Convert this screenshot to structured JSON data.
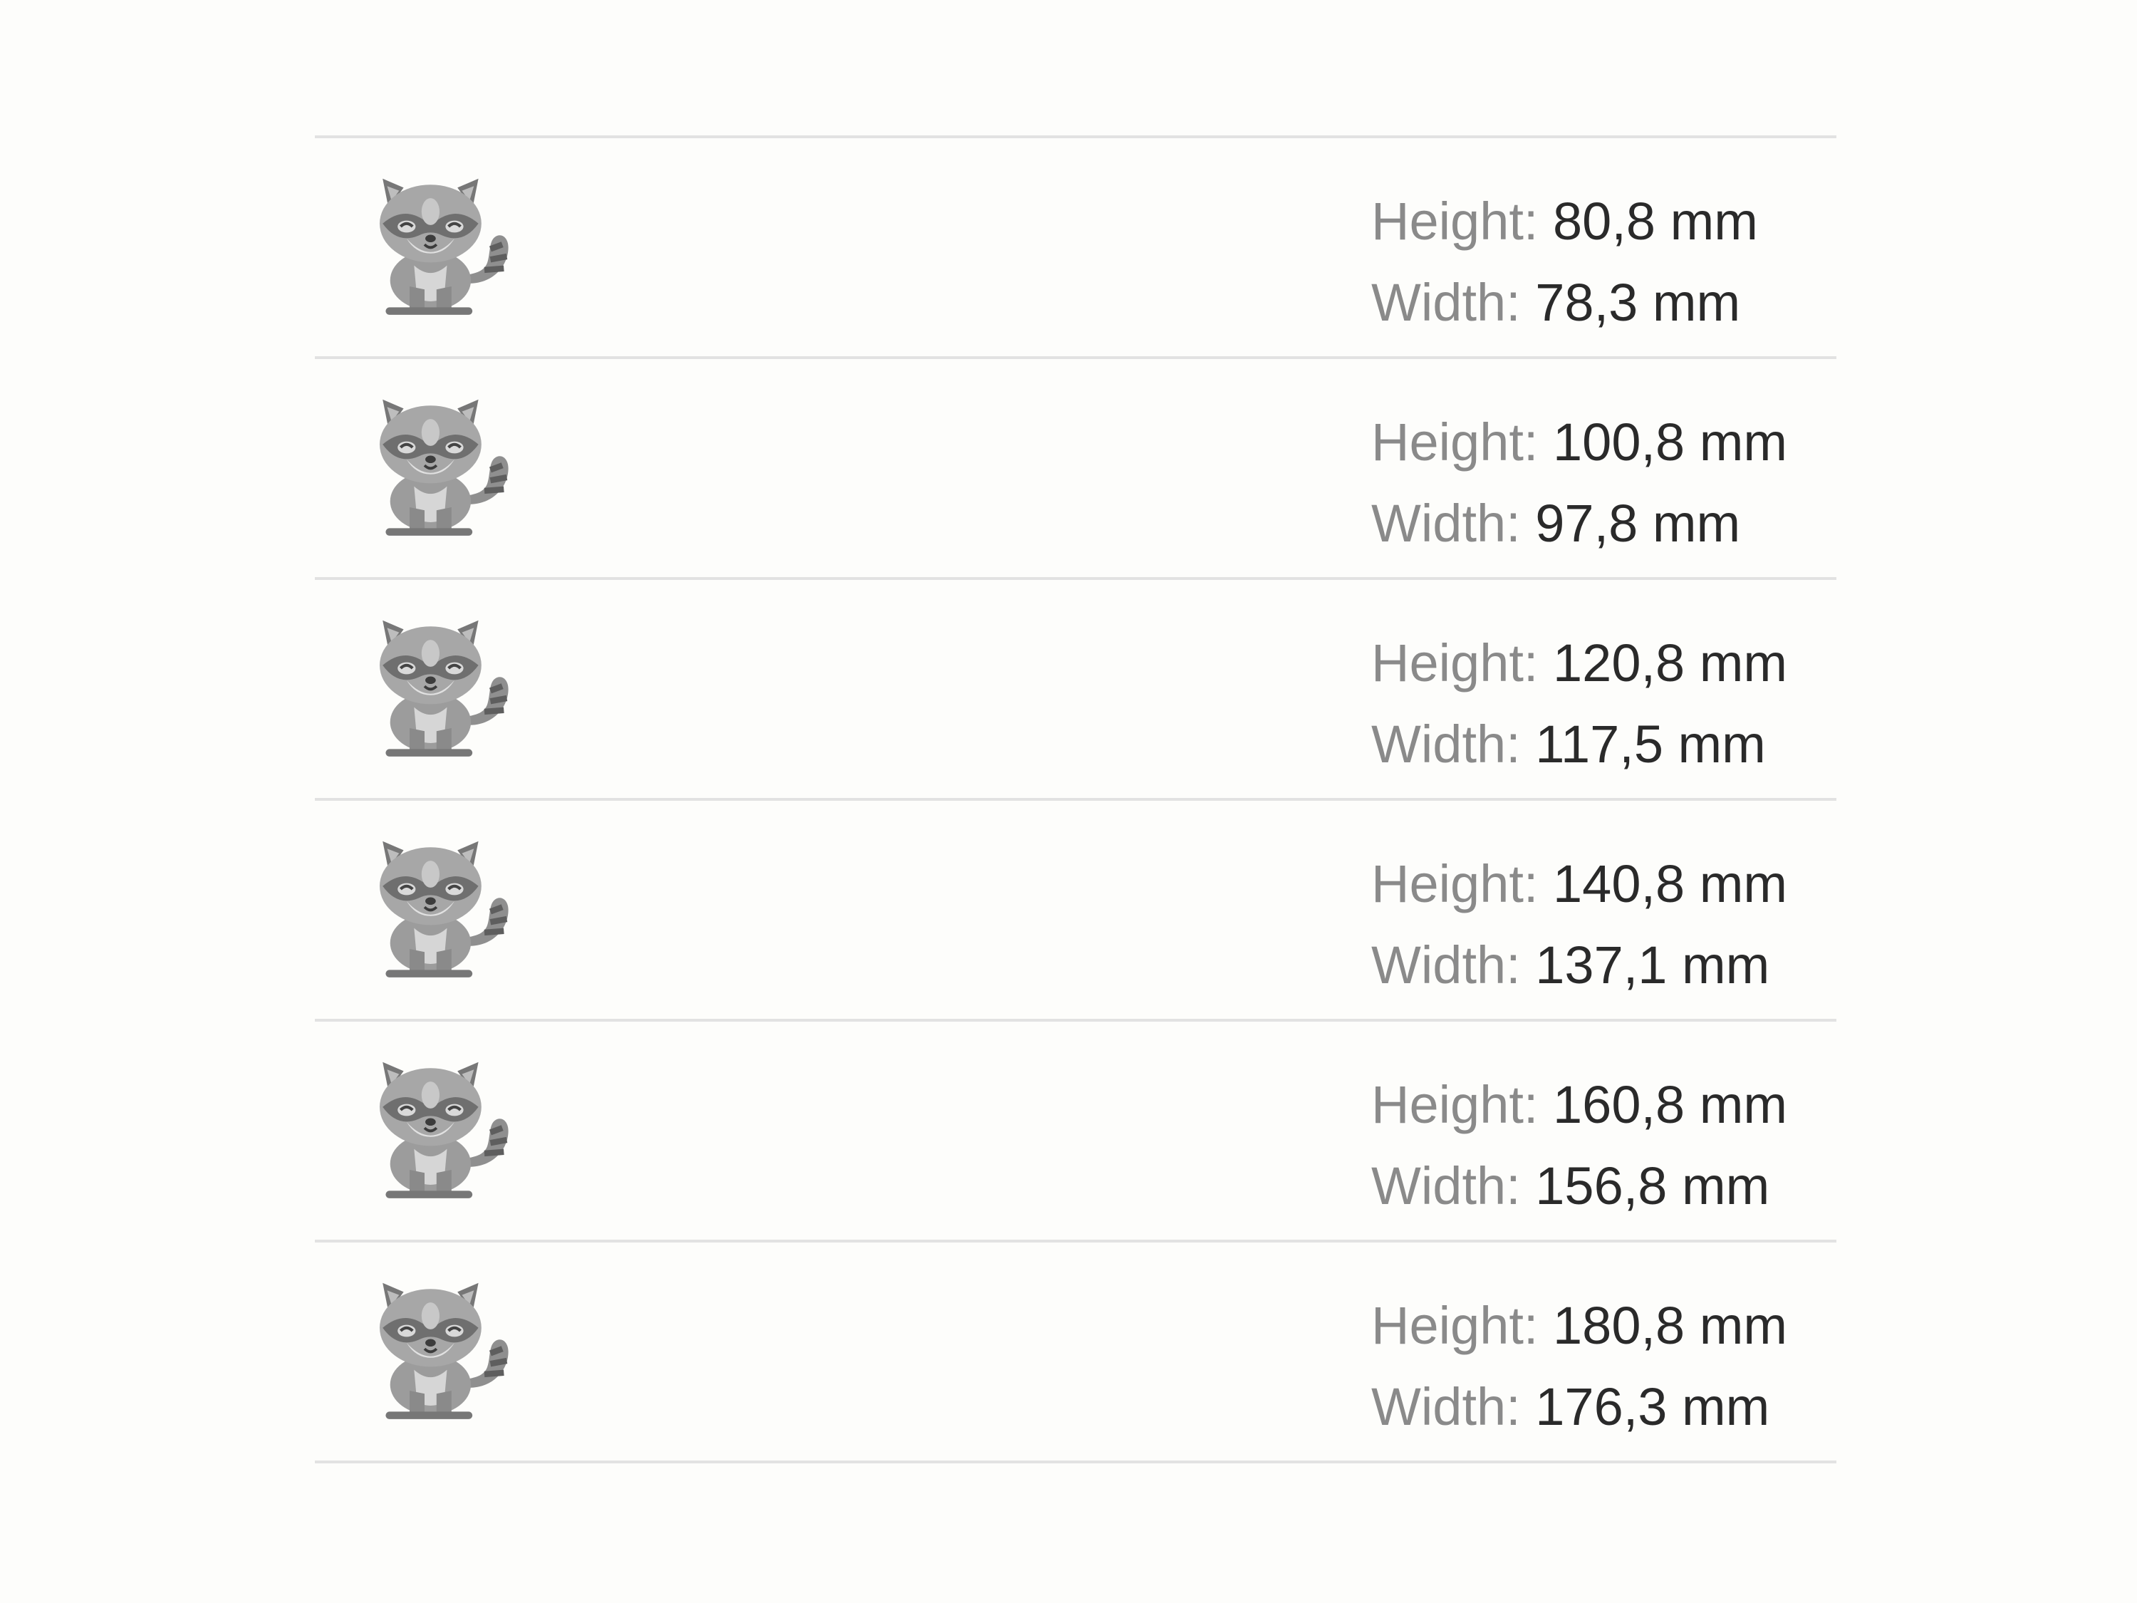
{
  "icon": "raccoon-icon",
  "colors": {
    "background": "#fdfdfb",
    "divider": "#e2e2e2",
    "label": "#8a8a8a",
    "value": "#2a2a2a"
  },
  "labels": {
    "height": "Height:",
    "width": "Width:"
  },
  "sizes": [
    {
      "height": "80,8 mm",
      "width": "78,3 mm"
    },
    {
      "height": "100,8 mm",
      "width": "97,8 mm"
    },
    {
      "height": "120,8 mm",
      "width": "117,5 mm"
    },
    {
      "height": "140,8 mm",
      "width": "137,1 mm"
    },
    {
      "height": "160,8 mm",
      "width": "156,8 mm"
    },
    {
      "height": "180,8 mm",
      "width": "176,3 mm"
    }
  ]
}
